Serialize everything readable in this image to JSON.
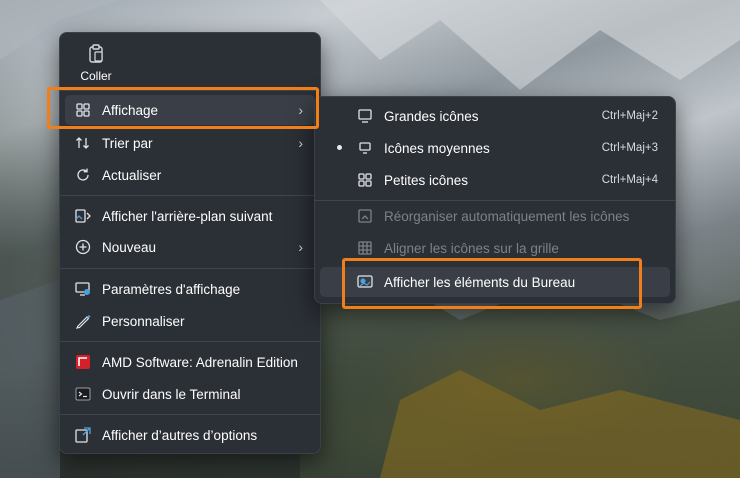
{
  "main_menu": {
    "paste_label": "Coller",
    "items": [
      {
        "label": "Affichage",
        "icon": "view-grid-icon",
        "submenu": true,
        "highlighted": true
      },
      {
        "label": "Trier par",
        "icon": "sort-icon",
        "submenu": true
      },
      {
        "label": "Actualiser",
        "icon": "refresh-icon"
      },
      {
        "label": "Afficher l'arrière-plan suivant",
        "icon": "next-background-icon"
      },
      {
        "label": "Nouveau",
        "icon": "new-plus-icon",
        "submenu": true
      },
      {
        "label": "Paramètres d'affichage",
        "icon": "display-settings-icon"
      },
      {
        "label": "Personnaliser",
        "icon": "pen-icon"
      },
      {
        "label": "AMD Software: Adrenalin Edition",
        "icon": "amd-icon"
      },
      {
        "label": "Ouvrir dans le Terminal",
        "icon": "terminal-icon"
      },
      {
        "label": "Afficher d’autres d’options",
        "icon": "more-options-icon"
      }
    ]
  },
  "sub_menu": {
    "items": [
      {
        "label": "Grandes icônes",
        "shortcut": "Ctrl+Maj+2",
        "icon": "monitor-large-icon"
      },
      {
        "label": "Icônes moyennes",
        "shortcut": "Ctrl+Maj+3",
        "icon": "monitor-medium-icon",
        "selected": true
      },
      {
        "label": "Petites icônes",
        "shortcut": "Ctrl+Maj+4",
        "icon": "small-grid-icon"
      },
      {
        "label": "Réorganiser automatiquement les icônes",
        "icon": "auto-arrange-icon",
        "disabled": true
      },
      {
        "label": "Aligner les icônes sur la grille",
        "icon": "align-grid-icon",
        "disabled": true
      },
      {
        "label": "Afficher les éléments du Bureau",
        "icon": "show-desktop-icons-icon",
        "highlighted": true
      }
    ]
  },
  "colors": {
    "highlight_border": "#f07f19",
    "menu_bg": "#2b2f36",
    "accent": "#4aa3e0"
  }
}
